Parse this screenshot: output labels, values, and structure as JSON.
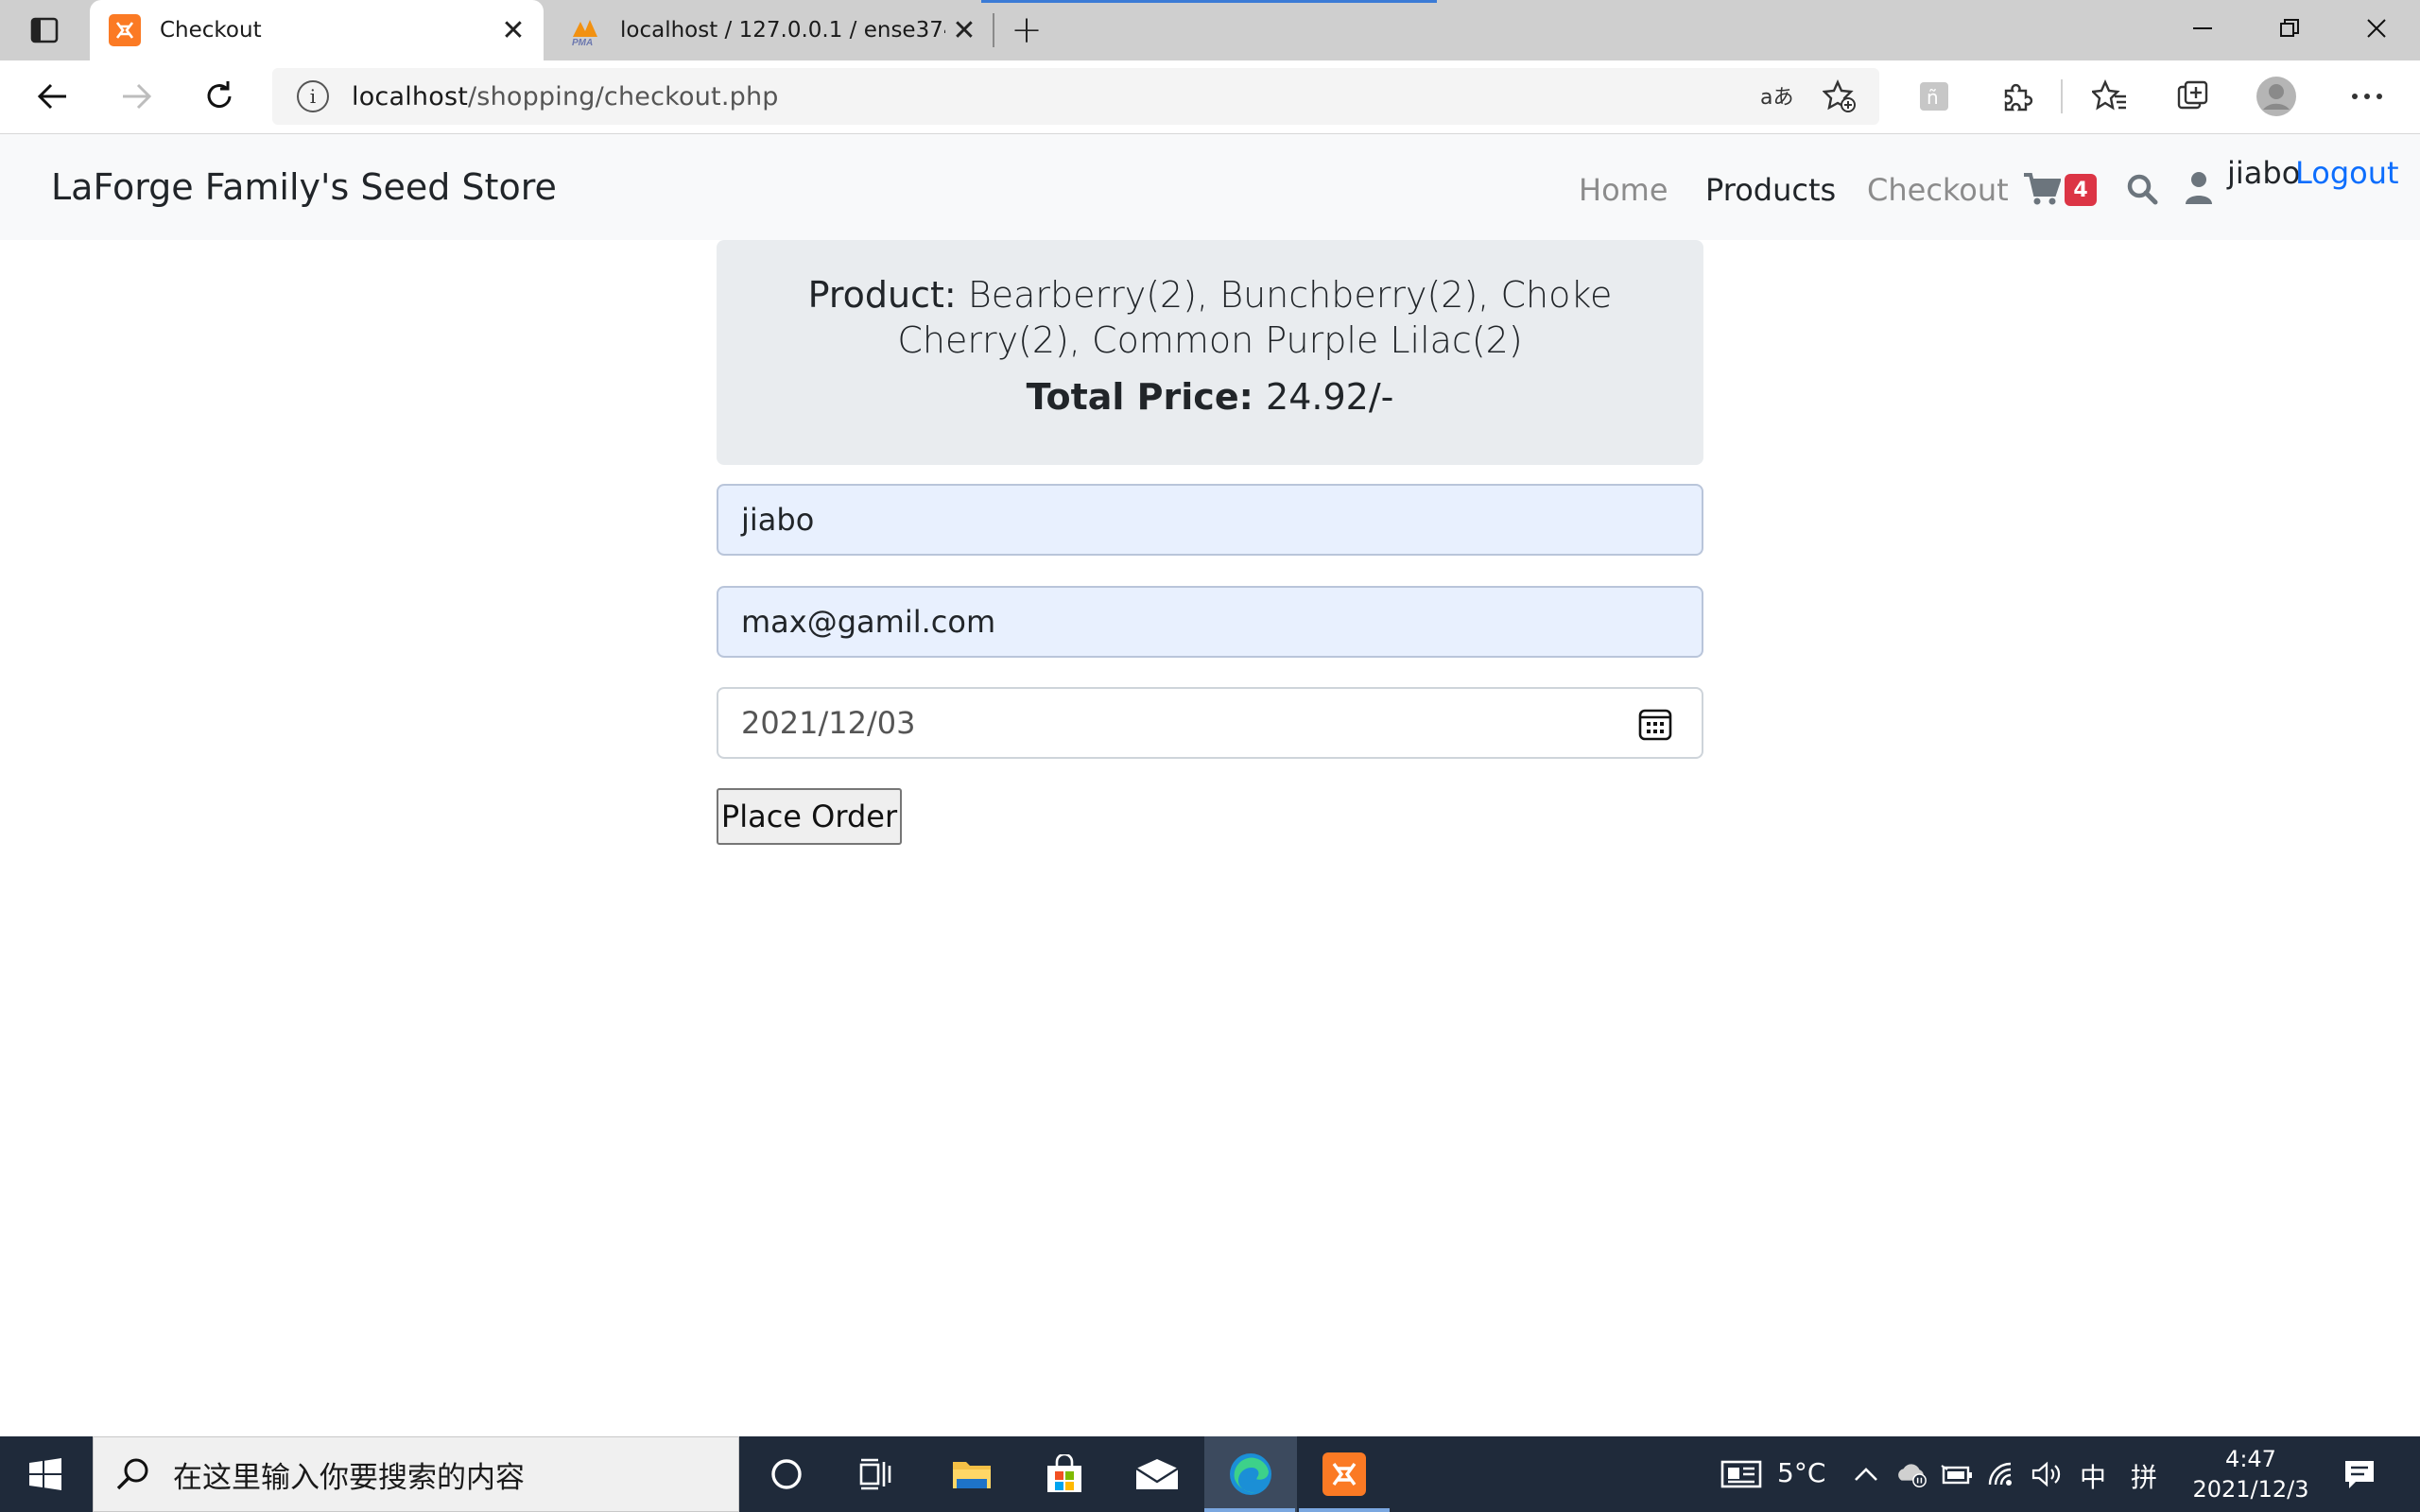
{
  "browser": {
    "tabs": [
      {
        "title": "Checkout",
        "active": true,
        "icon": "xampp-icon"
      },
      {
        "title": "localhost / 127.0.0.1 / ense374 / …",
        "active": false,
        "icon": "phpmyadmin-icon"
      }
    ],
    "url_host": "localhost",
    "url_path": "/shopping/checkout.php"
  },
  "site": {
    "brand": "LaForge Family's Seed Store",
    "nav": {
      "home": "Home",
      "products": "Products",
      "checkout": "Checkout",
      "cart_count": "4",
      "username": "jiabo",
      "logout": "Logout"
    }
  },
  "checkout": {
    "product_label": "Product:",
    "products": "Bearberry(2), Bunchberry(2), Choke Cherry(2), Common Purple Lilac(2)",
    "total_label": "Total Price:",
    "total_value": "24.92/-",
    "name_value": "jiabo",
    "email_value": "max@gamil.com",
    "date_value": "2021/12/03",
    "place_order": "Place Order"
  },
  "taskbar": {
    "search_placeholder": "在这里输入你要搜索的内容",
    "temperature": "5°C",
    "ime_lang": "中",
    "ime_mode": "拼",
    "time": "4:47",
    "date": "2021/12/3"
  },
  "colors": {
    "accent_link": "#0d6efd",
    "badge": "#dc3545",
    "navbar_bg": "#f8f9fa",
    "summary_bg": "#e9ecef",
    "autofill_bg": "#e8f0fe",
    "taskbar_bg": "#1f2a3a"
  }
}
